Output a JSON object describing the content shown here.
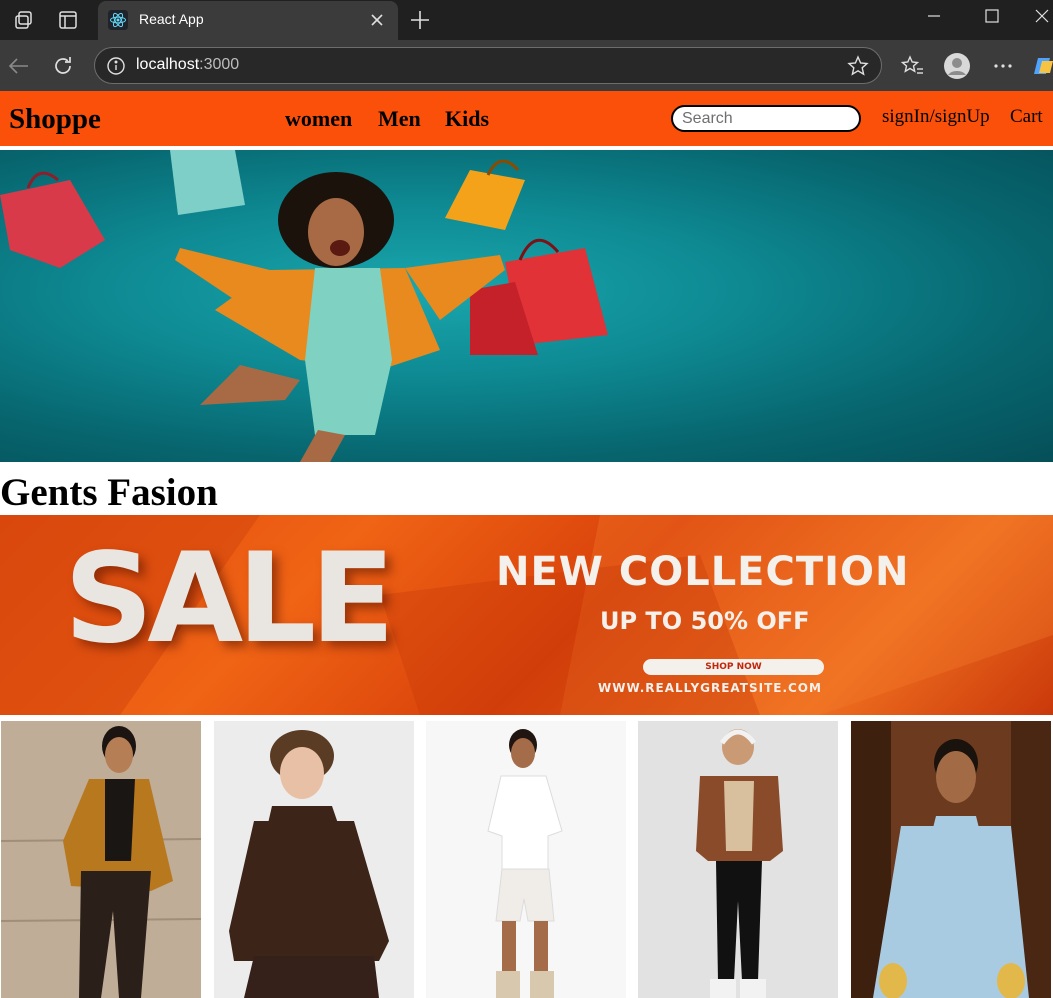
{
  "browser": {
    "tab_title": "React App",
    "url_host": "localhost",
    "url_port": ":3000"
  },
  "site": {
    "brand": "Shoppe",
    "nav": [
      "women",
      "Men",
      "Kids"
    ],
    "search_placeholder": "Search",
    "auth_link": "signIn/signUp",
    "cart_link": "Cart",
    "accent_color": "#fa500a"
  },
  "hero": {
    "image_alt": "Woman jumping with shopping bags on teal background",
    "bg_color": "#0e8a93"
  },
  "section": {
    "title": "Gents Fasion"
  },
  "sale_banner": {
    "big_word": "SALE",
    "headline": "NEW  COLLECTION",
    "offer": "UP TO 50% OFF",
    "button": "SHOP NOW",
    "website": "WWW.REALLYGREATSITE.COM"
  },
  "products": [
    {
      "alt": "Man in mustard jacket"
    },
    {
      "alt": "Young man in brown hoodie"
    },
    {
      "alt": "Man in white t-shirt and shorts"
    },
    {
      "alt": "Man in brown jacket with headphones"
    },
    {
      "alt": "Man in light blue kurta"
    }
  ]
}
